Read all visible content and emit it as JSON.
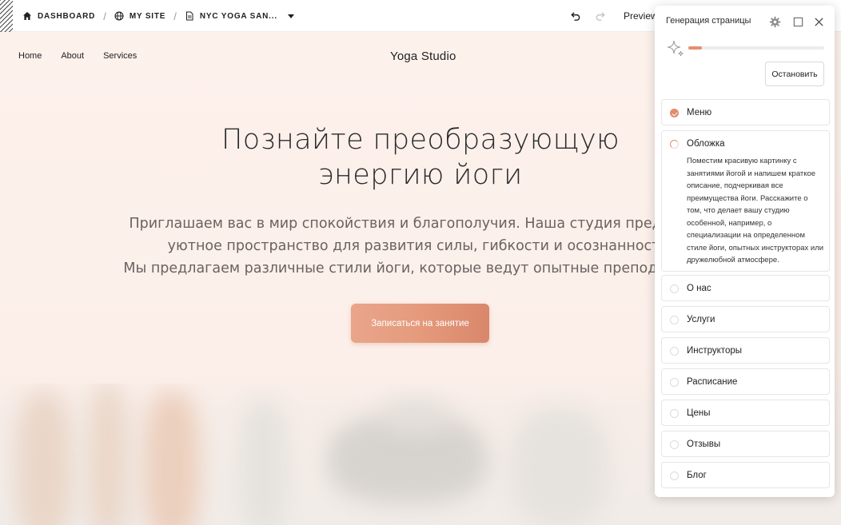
{
  "topbar": {
    "breadcrumbs": [
      {
        "label": "DASHBOARD",
        "icon": "home-icon"
      },
      {
        "label": "MY SITE",
        "icon": "globe-icon"
      },
      {
        "label": "NYC YOGA SAN...",
        "icon": "page-icon"
      }
    ],
    "preview_label": "Preview"
  },
  "site": {
    "nav": [
      "Home",
      "About",
      "Services"
    ],
    "logo": "Yoga Studio",
    "hero": {
      "title_lines": [
        "Познайте преобразующую",
        "энергию йоги"
      ],
      "text_lines": [
        "Приглашаем вас в мир спокойствия и благополучия. Наша студия предлагает",
        "уютное пространство для развития силы, гибкости и осознанности.",
        "Мы предлагаем различные стили йоги, которые ведут опытные преподаватели"
      ],
      "cta_label": "Записаться на занятие"
    }
  },
  "panel": {
    "title": "Генерация страницы",
    "progress": 0.1,
    "stop_label": "Остановить",
    "steps": [
      {
        "label": "Меню",
        "status": "done"
      },
      {
        "label": "Обложка",
        "status": "in-progress",
        "description": "Поместим красивую картинку с занятиями йогой и напишем краткое описание, подчеркивая все преимущества йоги. Расскажите о том, что делает вашу студию особенной, например, о специализации на определенном стиле йоги, опытных инструкторах или дружелюбной атмосфере."
      },
      {
        "label": "О нас",
        "status": "pending"
      },
      {
        "label": "Услуги",
        "status": "pending"
      },
      {
        "label": "Инструкторы",
        "status": "pending"
      },
      {
        "label": "Расписание",
        "status": "pending"
      },
      {
        "label": "Цены",
        "status": "pending"
      },
      {
        "label": "Отзывы",
        "status": "pending"
      },
      {
        "label": "Блог",
        "status": "pending"
      }
    ]
  },
  "colors": {
    "accent": "#e08c6d",
    "page_background": "#fdf1ec"
  }
}
